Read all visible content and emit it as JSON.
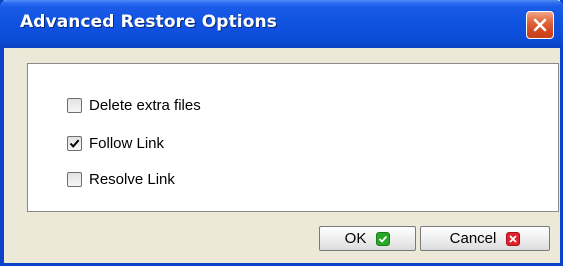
{
  "window": {
    "title": "Advanced Restore Options"
  },
  "options": [
    {
      "label": "Delete extra files",
      "checked": false
    },
    {
      "label": "Follow Link",
      "checked": true
    },
    {
      "label": "Resolve Link",
      "checked": false
    }
  ],
  "buttons": {
    "ok_label": "OK",
    "cancel_label": "Cancel"
  },
  "icons": {
    "close": "close-icon",
    "ok": "checkmark-icon",
    "cancel": "x-icon",
    "checkbox_checked": "checkmark-icon"
  },
  "colors": {
    "titlebar": "#1155e3",
    "frame": "#0a44c8",
    "dialog_bg": "#ece9d8",
    "close_button": "#d14a22",
    "ok_icon": "#27a627",
    "cancel_icon": "#e0212b"
  }
}
